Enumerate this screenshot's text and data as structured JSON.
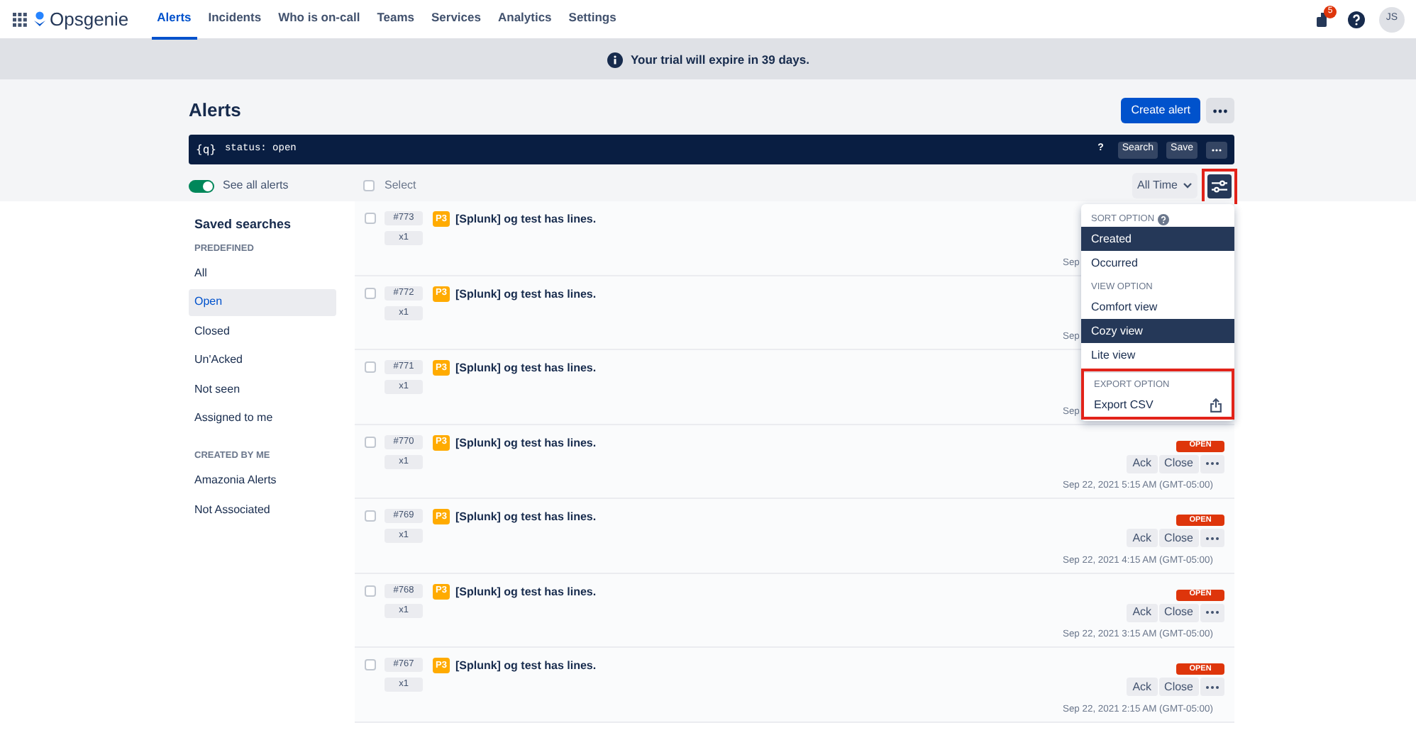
{
  "nav": {
    "product": "Opsgenie",
    "tabs": [
      {
        "label": "Alerts",
        "selected": true
      },
      {
        "label": "Incidents",
        "selected": false
      },
      {
        "label": "Who is on-call",
        "selected": false
      },
      {
        "label": "Teams",
        "selected": false
      },
      {
        "label": "Services",
        "selected": false
      },
      {
        "label": "Analytics",
        "selected": false
      },
      {
        "label": "Settings",
        "selected": false
      }
    ],
    "notification_count": "5",
    "avatar": "JS"
  },
  "banner": {
    "text": "Your trial will expire in 39 days."
  },
  "page": {
    "title": "Alerts",
    "create_button": "Create alert"
  },
  "query_bar": {
    "prefix": "{q}",
    "value": "status: open",
    "help": "?",
    "search": "Search",
    "save": "Save"
  },
  "toolbar": {
    "see_all": {
      "label": "See all alerts",
      "on": true
    },
    "select": {
      "label": "Select",
      "checked": false
    },
    "time_filter": "All Time",
    "filter_button_highlighted": true
  },
  "sidebar": {
    "title": "Saved searches",
    "groups": [
      {
        "heading": "PREDEFINED",
        "items": [
          {
            "label": "All",
            "selected": false
          },
          {
            "label": "Open",
            "selected": true
          },
          {
            "label": "Closed",
            "selected": false
          },
          {
            "label": "Un'Acked",
            "selected": false
          },
          {
            "label": "Not seen",
            "selected": false
          },
          {
            "label": "Assigned to me",
            "selected": false
          }
        ]
      },
      {
        "heading": "CREATED BY ME",
        "items": [
          {
            "label": "Amazonia Alerts",
            "selected": false
          },
          {
            "label": "Not Associated",
            "selected": false
          }
        ]
      }
    ]
  },
  "alerts": [
    {
      "id": "#773",
      "count": "x1",
      "priority": "P3",
      "title": "[Splunk] og test has lines.",
      "checked": false,
      "date": "Sep"
    },
    {
      "id": "#772",
      "count": "x1",
      "priority": "P3",
      "title": "[Splunk] og test has lines.",
      "checked": false,
      "date": "Sep"
    },
    {
      "id": "#771",
      "count": "x1",
      "priority": "P3",
      "title": "[Splunk] og test has lines.",
      "checked": false,
      "date": "Sep"
    },
    {
      "id": "#770",
      "count": "x1",
      "priority": "P3",
      "title": "[Splunk] og test has lines.",
      "checked": false,
      "status": "OPEN",
      "actions": [
        "Ack",
        "Close"
      ],
      "date": "Sep 22, 2021 5:15 AM (GMT-05:00)"
    },
    {
      "id": "#769",
      "count": "x1",
      "priority": "P3",
      "title": "[Splunk] og test has lines.",
      "checked": false,
      "status": "OPEN",
      "actions": [
        "Ack",
        "Close"
      ],
      "date": "Sep 22, 2021 4:15 AM (GMT-05:00)"
    },
    {
      "id": "#768",
      "count": "x1",
      "priority": "P3",
      "title": "[Splunk] og test has lines.",
      "checked": false,
      "status": "OPEN",
      "actions": [
        "Ack",
        "Close"
      ],
      "date": "Sep 22, 2021 3:15 AM (GMT-05:00)"
    },
    {
      "id": "#767",
      "count": "x1",
      "priority": "P3",
      "title": "[Splunk] og test has lines.",
      "checked": false,
      "status": "OPEN",
      "actions": [
        "Ack",
        "Close"
      ],
      "date": "Sep 22, 2021 2:15 AM (GMT-05:00)"
    }
  ],
  "options_menu": {
    "sections": [
      {
        "heading": "SORT OPTION",
        "help": true,
        "highlighted": false,
        "items": [
          {
            "label": "Created",
            "selected": true,
            "kind": "option"
          },
          {
            "label": "Occurred",
            "selected": false,
            "kind": "option"
          }
        ]
      },
      {
        "heading": "VIEW OPTION",
        "help": false,
        "highlighted": false,
        "items": [
          {
            "label": "Comfort view",
            "selected": false,
            "kind": "option"
          },
          {
            "label": "Cozy view",
            "selected": true,
            "kind": "option"
          },
          {
            "label": "Lite view",
            "selected": false,
            "kind": "option"
          }
        ]
      },
      {
        "heading": "EXPORT OPTION",
        "help": false,
        "highlighted": true,
        "items": [
          {
            "label": "Export CSV",
            "selected": false,
            "kind": "export"
          }
        ]
      }
    ]
  }
}
